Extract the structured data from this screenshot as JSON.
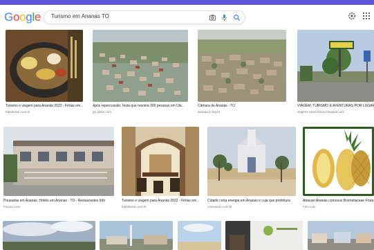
{
  "header": {
    "logo_letters": [
      {
        "char": "G",
        "color": "#4285f4"
      },
      {
        "char": "o",
        "color": "#ea4335"
      },
      {
        "char": "o",
        "color": "#fbbc05"
      },
      {
        "char": "g",
        "color": "#4285f4"
      },
      {
        "char": "l",
        "color": "#34a853"
      },
      {
        "char": "e",
        "color": "#ea4335"
      }
    ],
    "search_query": "Turismo em Ananas TO",
    "icons": [
      "camera-search-icon",
      "microphone-icon",
      "search-icon",
      "settings-icon",
      "apps-grid-icon"
    ]
  },
  "results": [
    {
      "caption": "Turismo e viagem para Ananás 2022 - Férias em ...",
      "source": "tripadvisor.com.br"
    },
    {
      "caption": "Após repercussão, festa que reuniria 300 pessoas em Ula...",
      "source": "g1.globo.com"
    },
    {
      "caption": "Câmara de Ananás - TO",
      "source": "ananas.to.leg.br"
    },
    {
      "caption": "VIAGEM, TURISMO E AVENTURAS POR LUGARES",
      "source": "viagens.carsecheria.blogspot.com"
    },
    {
      "caption": "Pousadas em Ananás, Hotéis em Ananás - TO - Restaurantes Info",
      "source": "Ficouni.com"
    },
    {
      "caption": "Turismo e viagem para Ananás 2022 - Férias em ...",
      "source": "tripadvisor.com.br"
    },
    {
      "caption": "Cidade corta energia em Ananás e cuja que prefeitura",
      "source": "conexaoto.com.br"
    },
    {
      "caption": "Abacaxi Ananás comosus Bromeliaceae Fruta",
      "source": "Folo.com"
    }
  ],
  "colors": {
    "accent": "#1a73e8",
    "backdrop": "#5b57d6",
    "caption": "#202124",
    "source": "#70757a"
  }
}
